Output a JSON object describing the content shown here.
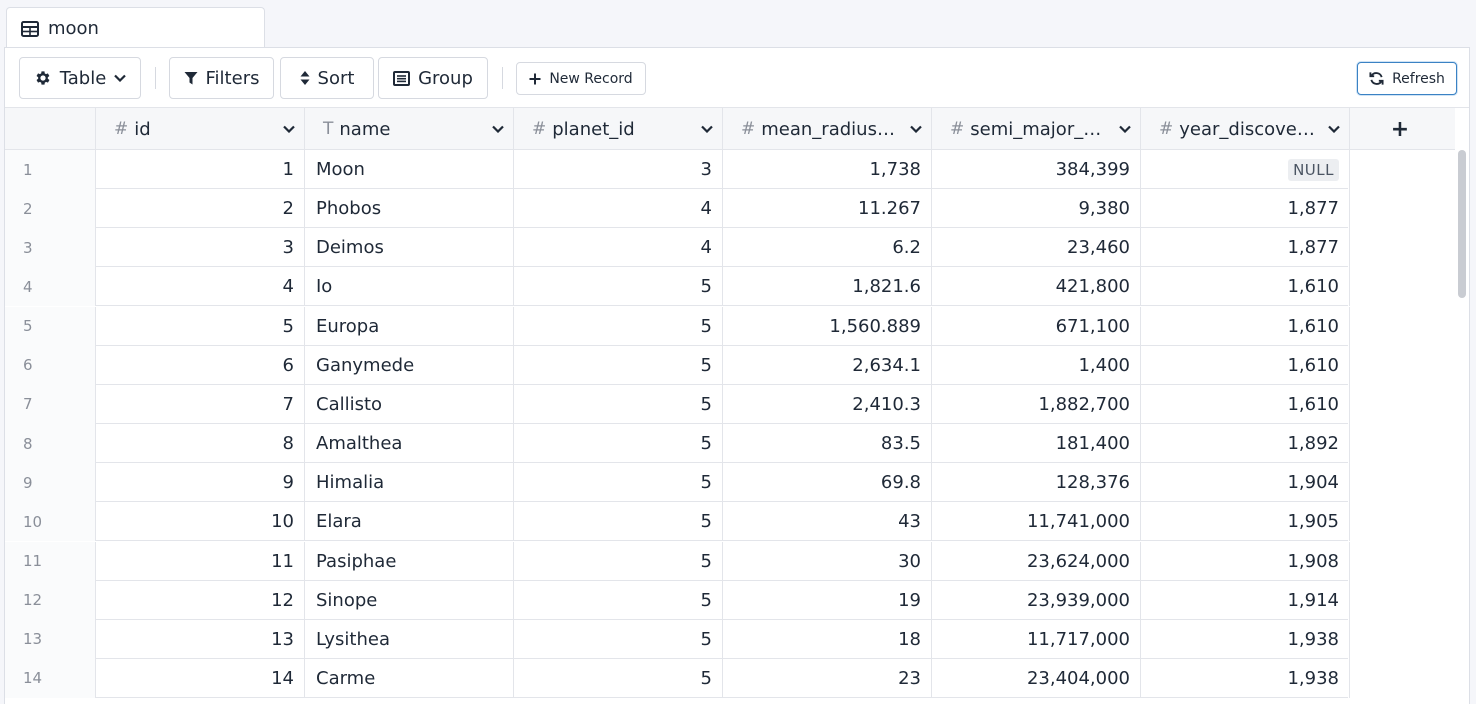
{
  "tab": {
    "label": "moon"
  },
  "toolbar": {
    "view_label": "Table",
    "filters_label": "Filters",
    "sort_label": "Sort",
    "group_label": "Group",
    "new_record_label": "New Record",
    "refresh_label": "Refresh"
  },
  "columns": [
    {
      "type_icon": "#",
      "label": "id"
    },
    {
      "type_icon": "T",
      "label": "name"
    },
    {
      "type_icon": "#",
      "label": "planet_id"
    },
    {
      "type_icon": "#",
      "label": "mean_radius_..."
    },
    {
      "type_icon": "#",
      "label": "semi_major_a..."
    },
    {
      "type_icon": "#",
      "label": "year_discover..."
    }
  ],
  "add_column_label": "+",
  "rows": [
    {
      "n": "1",
      "id": "1",
      "name": "Moon",
      "planet_id": "3",
      "mean_radius": "1,738",
      "semi_major": "384,399",
      "year": "NULL"
    },
    {
      "n": "2",
      "id": "2",
      "name": "Phobos",
      "planet_id": "4",
      "mean_radius": "11.267",
      "semi_major": "9,380",
      "year": "1,877"
    },
    {
      "n": "3",
      "id": "3",
      "name": "Deimos",
      "planet_id": "4",
      "mean_radius": "6.2",
      "semi_major": "23,460",
      "year": "1,877"
    },
    {
      "n": "4",
      "id": "4",
      "name": "Io",
      "planet_id": "5",
      "mean_radius": "1,821.6",
      "semi_major": "421,800",
      "year": "1,610"
    },
    {
      "n": "5",
      "id": "5",
      "name": "Europa",
      "planet_id": "5",
      "mean_radius": "1,560.889",
      "semi_major": "671,100",
      "year": "1,610"
    },
    {
      "n": "6",
      "id": "6",
      "name": "Ganymede",
      "planet_id": "5",
      "mean_radius": "2,634.1",
      "semi_major": "1,400",
      "year": "1,610"
    },
    {
      "n": "7",
      "id": "7",
      "name": "Callisto",
      "planet_id": "5",
      "mean_radius": "2,410.3",
      "semi_major": "1,882,700",
      "year": "1,610"
    },
    {
      "n": "8",
      "id": "8",
      "name": "Amalthea",
      "planet_id": "5",
      "mean_radius": "83.5",
      "semi_major": "181,400",
      "year": "1,892"
    },
    {
      "n": "9",
      "id": "9",
      "name": "Himalia",
      "planet_id": "5",
      "mean_radius": "69.8",
      "semi_major": "128,376",
      "year": "1,904"
    },
    {
      "n": "10",
      "id": "10",
      "name": "Elara",
      "planet_id": "5",
      "mean_radius": "43",
      "semi_major": "11,741,000",
      "year": "1,905"
    },
    {
      "n": "11",
      "id": "11",
      "name": "Pasiphae",
      "planet_id": "5",
      "mean_radius": "30",
      "semi_major": "23,624,000",
      "year": "1,908"
    },
    {
      "n": "12",
      "id": "12",
      "name": "Sinope",
      "planet_id": "5",
      "mean_radius": "19",
      "semi_major": "23,939,000",
      "year": "1,914"
    },
    {
      "n": "13",
      "id": "13",
      "name": "Lysithea",
      "planet_id": "5",
      "mean_radius": "18",
      "semi_major": "11,717,000",
      "year": "1,938"
    },
    {
      "n": "14",
      "id": "14",
      "name": "Carme",
      "planet_id": "5",
      "mean_radius": "23",
      "semi_major": "23,404,000",
      "year": "1,938"
    }
  ]
}
